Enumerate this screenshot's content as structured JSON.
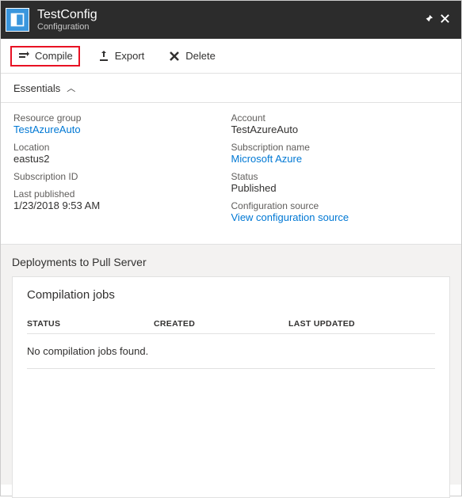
{
  "header": {
    "title": "TestConfig",
    "subtitle": "Configuration"
  },
  "toolbar": {
    "compile": "Compile",
    "export": "Export",
    "delete": "Delete"
  },
  "essentials": {
    "toggle_label": "Essentials",
    "left": [
      {
        "label": "Resource group",
        "value": "TestAzureAuto",
        "link": true
      },
      {
        "label": "Location",
        "value": "eastus2",
        "link": false
      },
      {
        "label": "Subscription ID",
        "value": "",
        "link": false
      },
      {
        "label": "Last published",
        "value": "1/23/2018 9:53 AM",
        "link": false
      }
    ],
    "right": [
      {
        "label": "Account",
        "value": "TestAzureAuto",
        "link": false
      },
      {
        "label": "Subscription name",
        "value": "Microsoft Azure",
        "link": true
      },
      {
        "label": "Status",
        "value": "Published",
        "link": false
      },
      {
        "label": "Configuration source",
        "value": "View configuration source",
        "link": true
      }
    ]
  },
  "section": {
    "title": "Deployments to Pull Server",
    "card_title": "Compilation jobs",
    "columns": {
      "status": "STATUS",
      "created": "CREATED",
      "updated": "LAST UPDATED"
    },
    "empty": "No compilation jobs found."
  }
}
